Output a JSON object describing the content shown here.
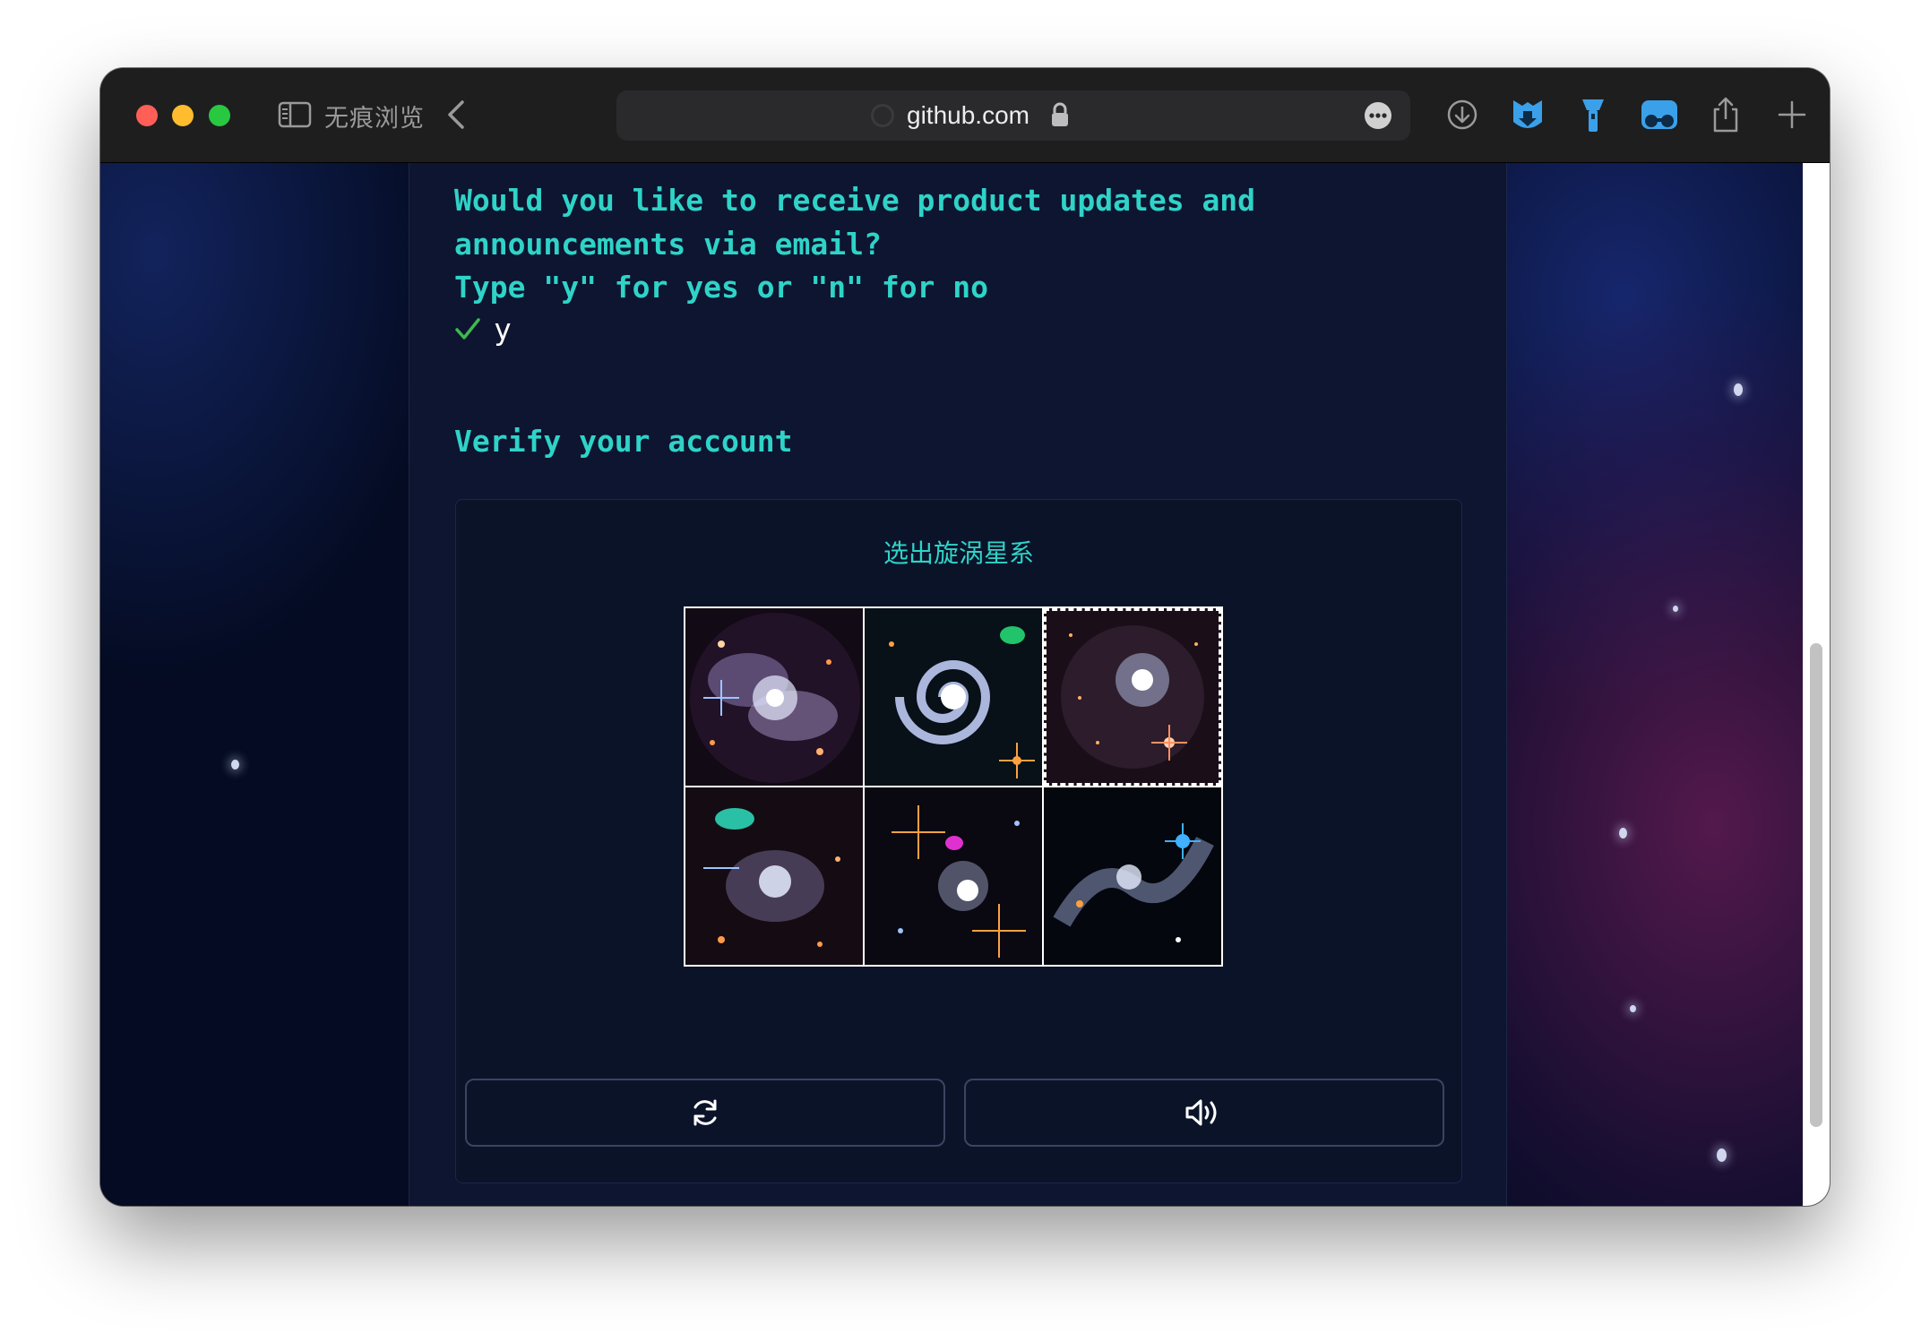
{
  "browser": {
    "tab_title": "无痕浏览",
    "url": "github.com"
  },
  "signup": {
    "question": "Would you like to receive product updates and\nannouncements via email?\nType \"y\" for yes or \"n\" for no",
    "answer": "y",
    "verify_title": "Verify your account"
  },
  "captcha": {
    "prompt": "选出旋涡星系",
    "tiles": [
      {
        "name": "tile-1",
        "content": "galaxy cluster",
        "selected": false
      },
      {
        "name": "tile-2",
        "content": "spiral galaxy",
        "selected": false
      },
      {
        "name": "tile-3",
        "content": "star field",
        "selected": true
      },
      {
        "name": "tile-4",
        "content": "galaxy cluster",
        "selected": false
      },
      {
        "name": "tile-5",
        "content": "star field",
        "selected": false
      },
      {
        "name": "tile-6",
        "content": "nebula",
        "selected": false
      }
    ],
    "buttons": {
      "refresh": "refresh-icon",
      "audio": "speaker-icon"
    }
  },
  "colors": {
    "accent": "#2fd3c8",
    "check": "#3fb950",
    "panel": "#0d1530"
  }
}
